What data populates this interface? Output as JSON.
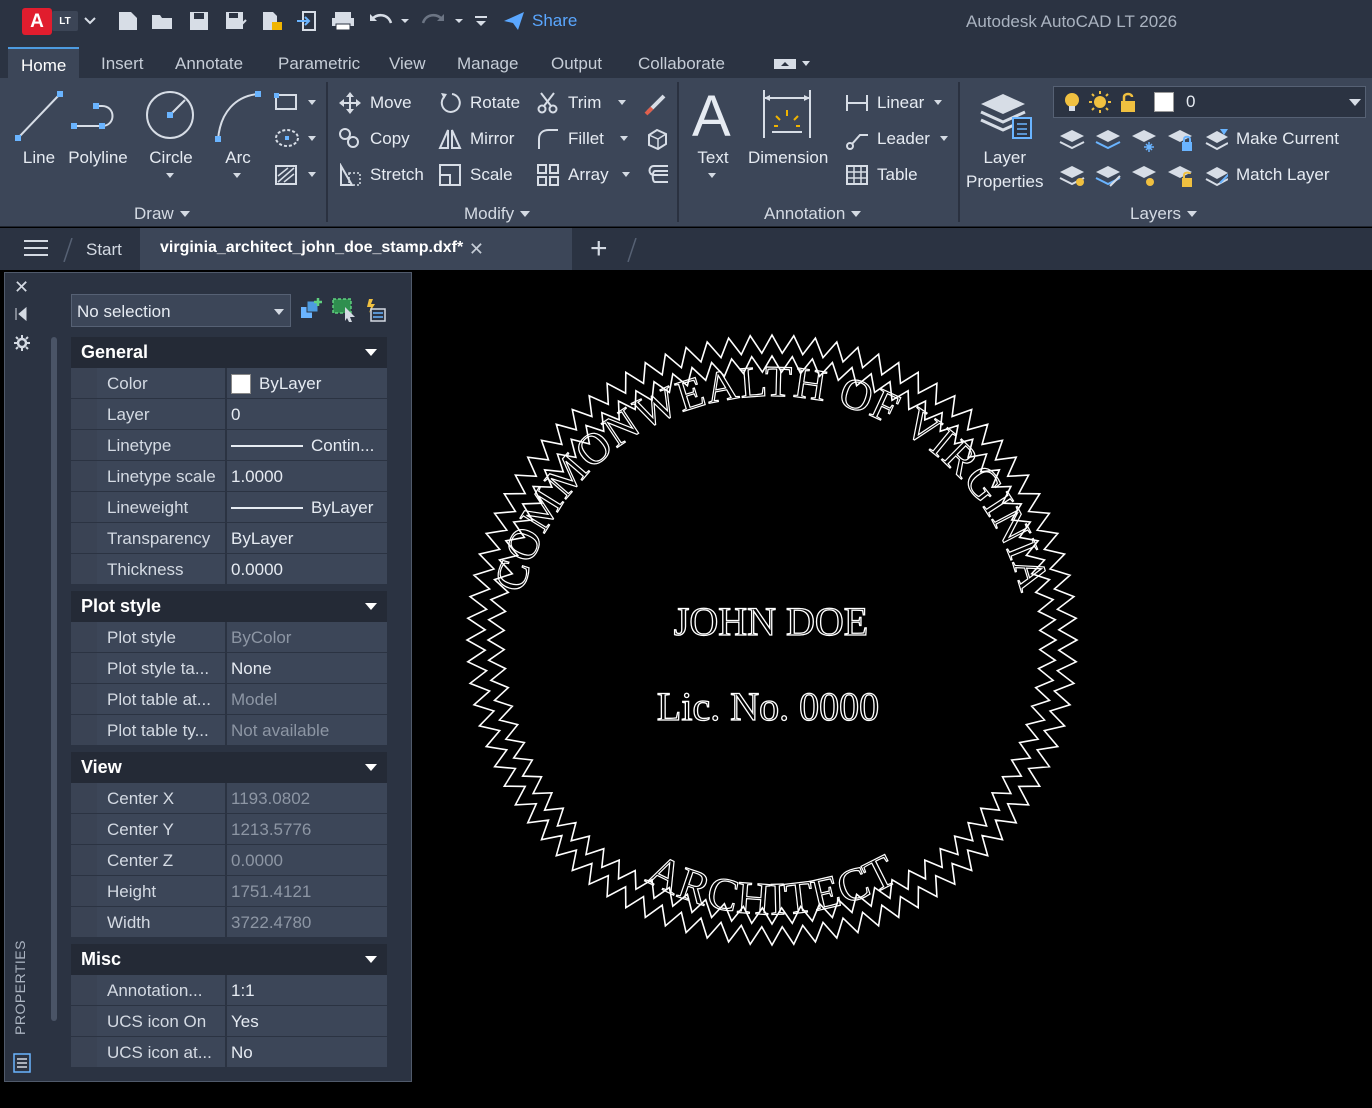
{
  "app": {
    "logo_letter": "A",
    "logo_badge": "LT",
    "title": "Autodesk AutoCAD LT 2026",
    "share_label": "Share"
  },
  "ribbon_tabs": [
    "Home",
    "Insert",
    "Annotate",
    "Parametric",
    "View",
    "Manage",
    "Output",
    "Collaborate"
  ],
  "ribbon": {
    "draw": {
      "title": "Draw",
      "line": "Line",
      "polyline": "Polyline",
      "circle": "Circle",
      "arc": "Arc"
    },
    "modify": {
      "title": "Modify",
      "move": "Move",
      "rotate": "Rotate",
      "trim": "Trim",
      "copy": "Copy",
      "mirror": "Mirror",
      "fillet": "Fillet",
      "stretch": "Stretch",
      "scale": "Scale",
      "array": "Array"
    },
    "annotation": {
      "title": "Annotation",
      "text": "Text",
      "dimension": "Dimension",
      "linear": "Linear",
      "leader": "Leader",
      "table": "Table"
    },
    "layers": {
      "title": "Layers",
      "layer_properties_1": "Layer",
      "layer_properties_2": "Properties",
      "current_layer": "0",
      "make_current": "Make Current",
      "match_layer": "Match Layer"
    }
  },
  "doc_tabs": {
    "start": "Start",
    "active_file": "virginia_architect_john_doe_stamp.dxf*"
  },
  "properties": {
    "palette_label": "PROPERTIES",
    "selection": "No selection",
    "sections": {
      "general": {
        "title": "General",
        "rows": [
          {
            "key": "Color",
            "val": "ByLayer"
          },
          {
            "key": "Layer",
            "val": "0"
          },
          {
            "key": "Linetype",
            "val": "Contin..."
          },
          {
            "key": "Linetype scale",
            "val": "1.0000"
          },
          {
            "key": "Lineweight",
            "val": "ByLayer"
          },
          {
            "key": "Transparency",
            "val": "ByLayer"
          },
          {
            "key": "Thickness",
            "val": "0.0000"
          }
        ]
      },
      "plot_style": {
        "title": "Plot style",
        "rows": [
          {
            "key": "Plot style",
            "val": "ByColor"
          },
          {
            "key": "Plot style ta...",
            "val": "None"
          },
          {
            "key": "Plot table at...",
            "val": "Model"
          },
          {
            "key": "Plot table ty...",
            "val": "Not available"
          }
        ]
      },
      "view": {
        "title": "View",
        "rows": [
          {
            "key": "Center X",
            "val": "1193.0802"
          },
          {
            "key": "Center Y",
            "val": "1213.5776"
          },
          {
            "key": "Center Z",
            "val": "0.0000"
          },
          {
            "key": "Height",
            "val": "1751.4121"
          },
          {
            "key": "Width",
            "val": "3722.4780"
          }
        ]
      },
      "misc": {
        "title": "Misc",
        "rows": [
          {
            "key": "Annotation...",
            "val": "1:1"
          },
          {
            "key": "UCS icon On",
            "val": "Yes"
          },
          {
            "key": "UCS icon at...",
            "val": "No"
          }
        ]
      }
    }
  },
  "drawing": {
    "top_arc_text": "COMMONWEALTH OF VIRGINIA",
    "bottom_arc_text": "ARCHITECT",
    "name": "JOHN DOE",
    "license": "Lic. No. 0000"
  },
  "colors": {
    "accent": "#4d9be0",
    "share": "#5aa7ff",
    "ribbon_bg": "#3c4658",
    "title_bg": "#2b3342"
  }
}
